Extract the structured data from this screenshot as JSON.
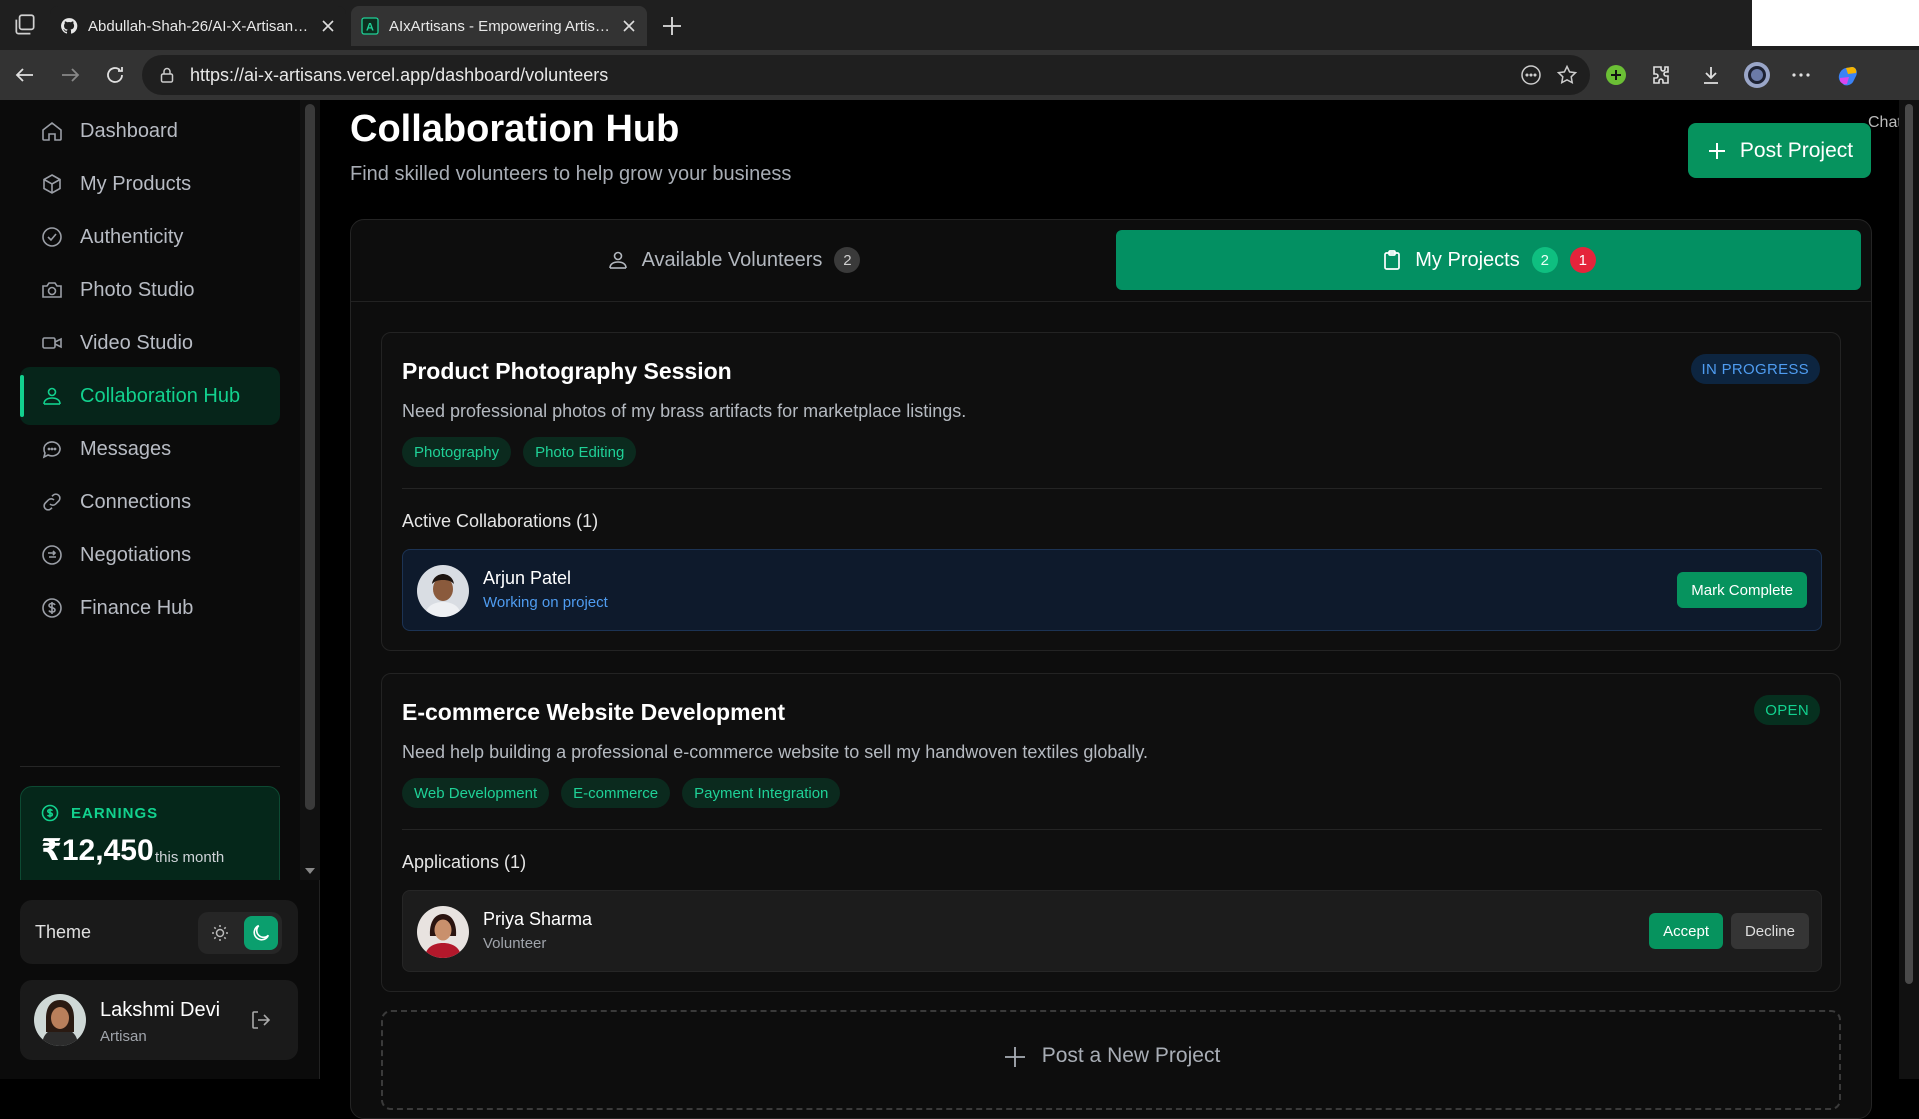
{
  "browser": {
    "tabs": [
      {
        "title": "Abdullah-Shah-26/AI-X-Artisans: A",
        "icon": "github-icon"
      },
      {
        "title": "AIxArtisans - Empowering Artisans",
        "icon": "app-icon"
      }
    ],
    "url": "https://ai-x-artisans.vercel.app/dashboard/volunteers",
    "chat_label": "Chat"
  },
  "sidebar": {
    "items": [
      {
        "label": "Dashboard",
        "icon": "home-icon"
      },
      {
        "label": "My Products",
        "icon": "box-icon"
      },
      {
        "label": "Authenticity",
        "icon": "check-circle-icon"
      },
      {
        "label": "Photo Studio",
        "icon": "camera-icon"
      },
      {
        "label": "Video Studio",
        "icon": "video-icon"
      },
      {
        "label": "Collaboration Hub",
        "icon": "users-icon",
        "active": true
      },
      {
        "label": "Messages",
        "icon": "message-icon"
      },
      {
        "label": "Connections",
        "icon": "link-icon"
      },
      {
        "label": "Negotiations",
        "icon": "handshake-icon"
      },
      {
        "label": "Finance Hub",
        "icon": "dollar-icon"
      }
    ],
    "earnings": {
      "label": "EARNINGS",
      "amount": "₹12,450",
      "period": "this month"
    },
    "theme_label": "Theme",
    "user": {
      "name": "Lakshmi Devi",
      "role": "Artisan"
    }
  },
  "header": {
    "title": "Collaboration Hub",
    "subtitle": "Find skilled volunteers to help grow your business",
    "post_button": "Post Project"
  },
  "tabs": {
    "volunteers": {
      "label": "Available Volunteers",
      "count": "2"
    },
    "projects": {
      "label": "My Projects",
      "count": "2",
      "alert": "1"
    }
  },
  "projects": [
    {
      "title": "Product Photography Session",
      "status": "IN PROGRESS",
      "description": "Need professional photos of my brass artifacts for marketplace listings.",
      "tags": [
        "Photography",
        "Photo Editing"
      ],
      "section_label": "Active Collaborations (1)",
      "person": {
        "name": "Arjun Patel",
        "status": "Working on project"
      },
      "action": "Mark Complete"
    },
    {
      "title": "E-commerce Website Development",
      "status": "OPEN",
      "description": "Need help building a professional e-commerce website to sell my handwoven textiles globally.",
      "tags": [
        "Web Development",
        "E-commerce",
        "Payment Integration"
      ],
      "section_label": "Applications (1)",
      "person": {
        "name": "Priya Sharma",
        "status": "Volunteer"
      },
      "accept": "Accept",
      "decline": "Decline"
    }
  ],
  "post_new": "Post a New Project",
  "colors": {
    "accent": "#06935e",
    "accent_text": "#12d18e",
    "in_progress": "#4f9cf0",
    "alert": "#e5243b"
  }
}
